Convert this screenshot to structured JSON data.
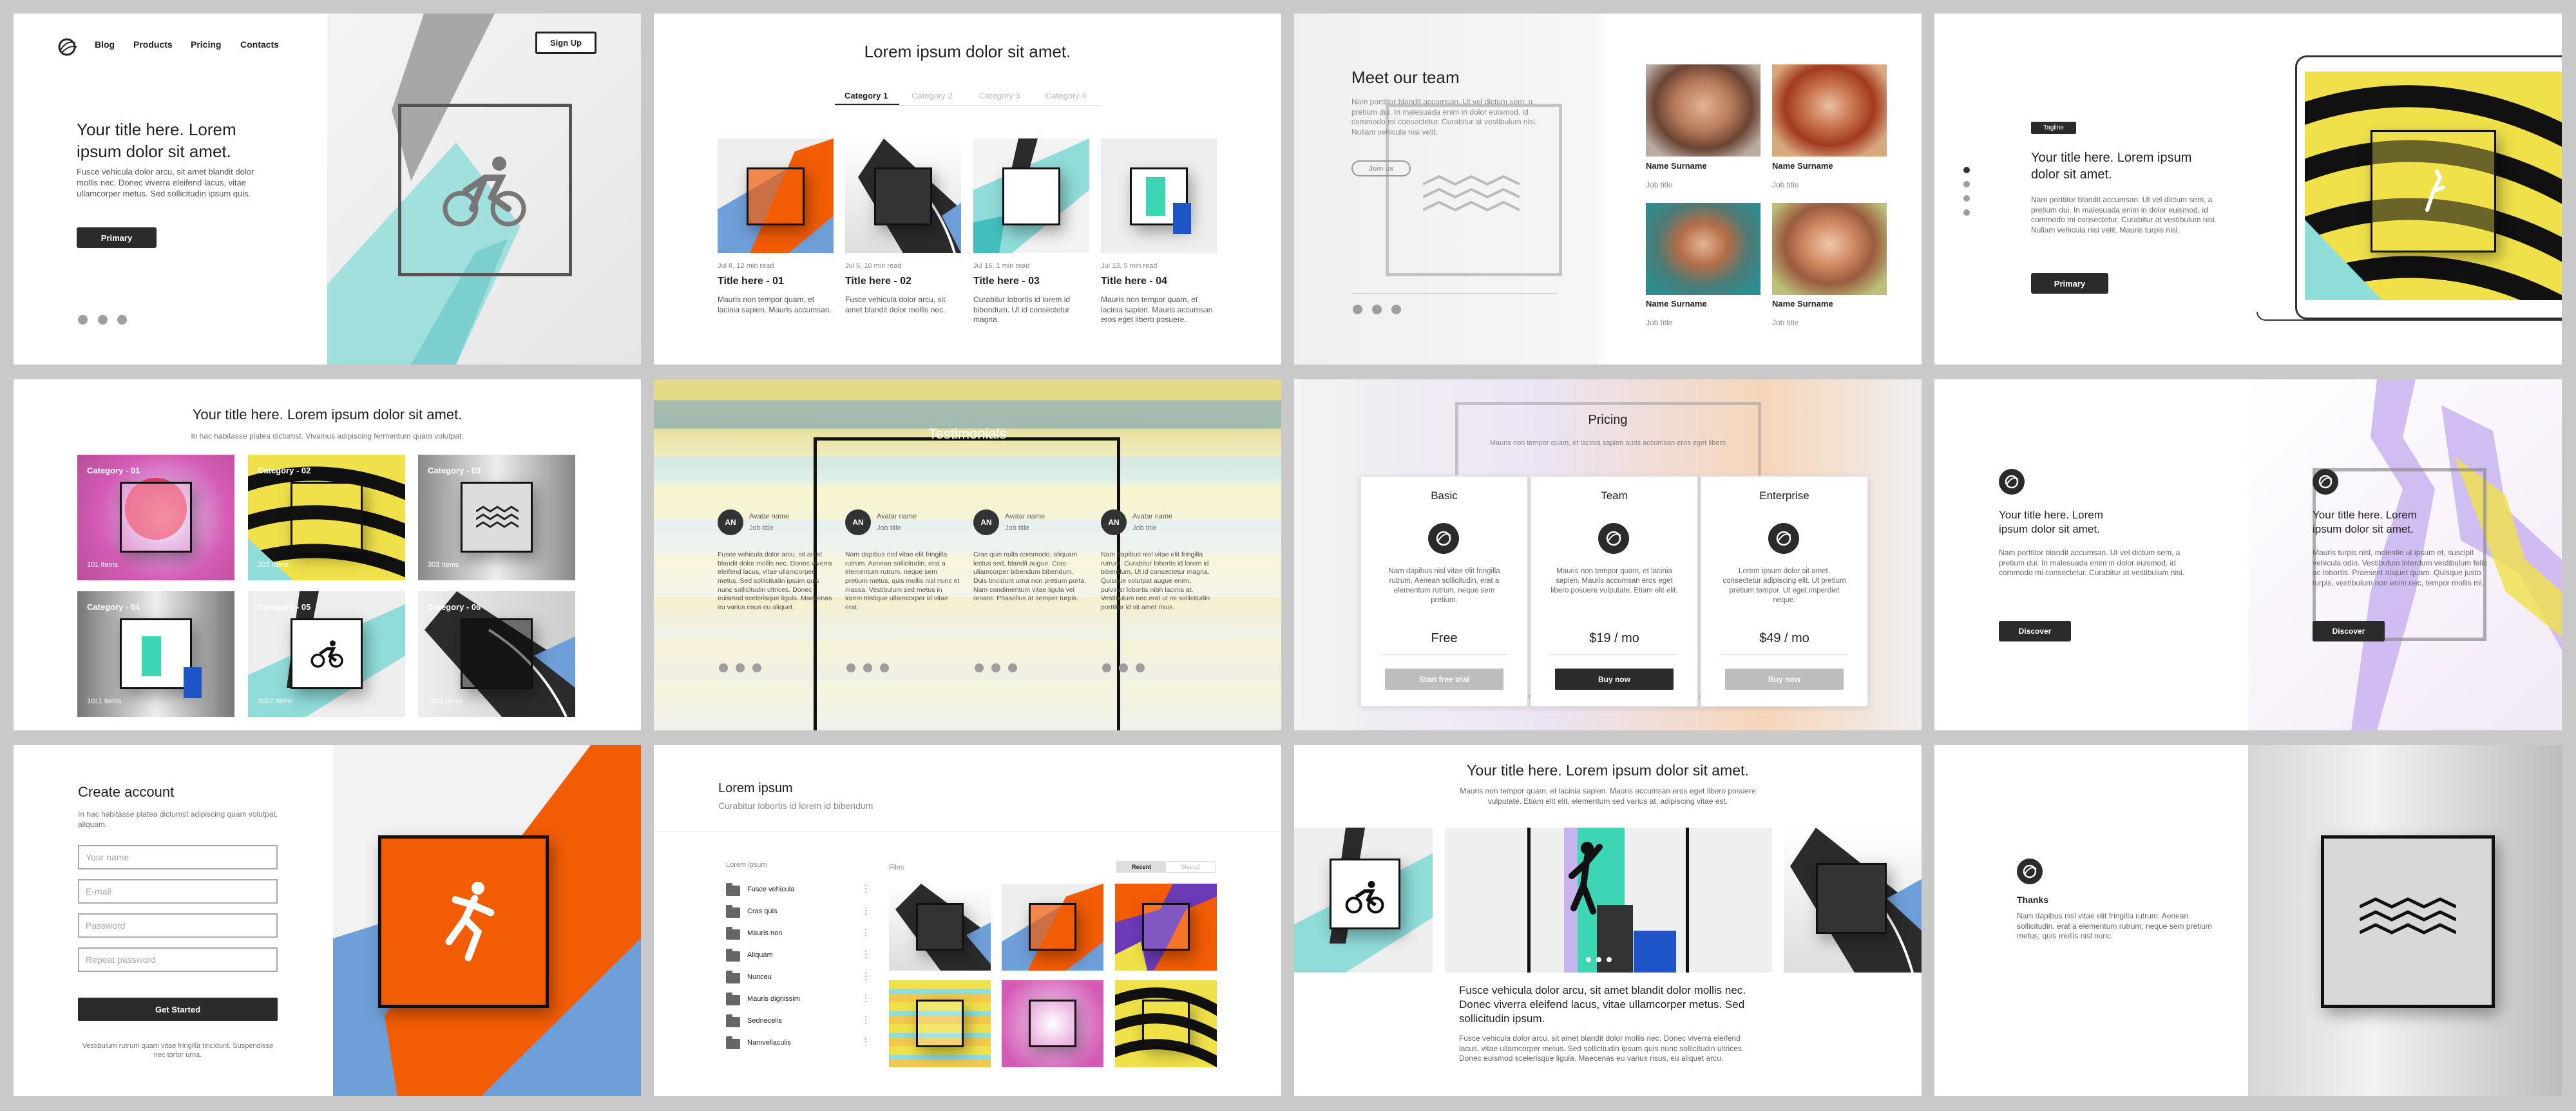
{
  "s1": {
    "nav": [
      "Blog",
      "Products",
      "Pricing",
      "Contacts"
    ],
    "signup": "Sign Up",
    "title": "Your title here. Lorem ipsum dolor sit amet.",
    "body": "Fusce vehicula dolor arcu, sit amet blandit dolor mollis nec. Donec viverra eleifend lacus, vitae ullamcorper metus. Sed sollicitudin ipsum quis.",
    "button": "Primary",
    "logo_icon": "globe-logo-icon",
    "art_icon": "cyclist-icon"
  },
  "s2": {
    "title": "Lorem ipsum dolor sit amet.",
    "tabs": [
      "Category 1",
      "Category 2",
      "Category 3",
      "Category 4"
    ],
    "posts": [
      {
        "meta": "Jul 8, 12 min read",
        "title": "Title here - 01",
        "text": "Mauris non tempor quam, et lacinia sapien. Mauris accumsan."
      },
      {
        "meta": "Jul 6, 10 min read",
        "title": "Title here - 02",
        "text": "Fusce vehicula dolor arcu, sit amet blandit dolor mollis nec."
      },
      {
        "meta": "Jul 16, 1 min read",
        "title": "Title here - 03",
        "text": "Curabitur lobortis id lorem id bibendum. Ut id consectetur magna."
      },
      {
        "meta": "Jul 13, 5 min read",
        "title": "Title here - 04",
        "text": "Mauris non tempor quam, et lacinia sapien. Mauris accumsan eros eget libero posuere."
      }
    ]
  },
  "s3": {
    "title": "Meet our team",
    "text": "Nam porttitor blandit accumsan. Ut vel dictum sem, a pretium dui. In malesuada enim in dolor euismod, id commodo mi consectetur. Curabitur at vestibulum nisi. Nullam vehicula nisi velit.",
    "button": "Join us",
    "members": [
      {
        "name": "Name Surname",
        "job": "Job title"
      },
      {
        "name": "Name Surname",
        "job": "Job title"
      },
      {
        "name": "Name Surname",
        "job": "Job title"
      },
      {
        "name": "Name Surname",
        "job": "Job title"
      }
    ]
  },
  "s4": {
    "tagline": "Tagline",
    "title": "Your title here. Lorem ipsum dolor sit amet.",
    "text": "Nam porttitor blandit accumsan. Ut vel dictum sem, a pretium dui. In malesuada enim in dolor euismod, id commodo mi consectetur. Curabitur at vestibulum nisi. Nullam vehicula nisi velit. Mauris turpis nisl.",
    "button": "Primary"
  },
  "s5": {
    "title": "Your title here. Lorem ipsum dolor sit amet.",
    "subtitle": "In hac habitasse platea dictumst. Vivamus adipiscing fermentum quam volutpat.",
    "cats": [
      {
        "name": "Category - 01",
        "count": "101 Items"
      },
      {
        "name": "Category - 02",
        "count": "202 Items"
      },
      {
        "name": "Category - 03",
        "count": "303 Items"
      },
      {
        "name": "Category - 04",
        "count": "1011 Items"
      },
      {
        "name": "Category - 05",
        "count": "2022 Items"
      },
      {
        "name": "Category - 06",
        "count": "3033 Items"
      }
    ]
  },
  "s6": {
    "title": "Testimonials",
    "items": [
      {
        "initials": "AN",
        "name": "Avatar name",
        "job": "Job title",
        "text": "Fusce vehicula dolor arcu, sit amet blandit dolor mollis nec. Donec viverra eleifend lacus, vitae ullamcorper metus. Sed sollicitudin ipsum quis nunc sollicitudin ultrices. Donec euismod scelerisque ligula. Maecenas eu varius risus eu aliquet."
      },
      {
        "initials": "AN",
        "name": "Avatar name",
        "job": "Job title",
        "text": "Nam dapibus nisl vitae elit fringilla rutrum. Aenean sollicitudin, erat a elementum rutrum, neque sem pretium metus, quis mollis nisl nunc et massa. Vestibulum sed metus in lorem tristique ullamcorper id vitae erat."
      },
      {
        "initials": "AN",
        "name": "Avatar name",
        "job": "Job title",
        "text": "Cras quis nulla commodo, aliquam lectus sed, blandit augue. Cras ullamcorper bibendum bibendum. Duis tincidunt urna non pretium porta. Nam condimentum vitae ligula vel ornare. Phasellus at semper turpis."
      },
      {
        "initials": "AN",
        "name": "Avatar name",
        "job": "Job title",
        "text": "Nam dapibus nisl vitae elit fringilla rutrum. Curabitur lobortis id lorem id bibendum. Ut id consectetur magna. Quisque volutpat augue enim, pulvinar lobortis nibh lacinia at. Vestibulum nec erat ut mi sollicitudin porttitor id sit amet risus."
      }
    ]
  },
  "s7": {
    "title": "Pricing",
    "subtitle": "Mauris non tempor quam, et lacinia sapien auris accumsan eros eget libero",
    "plans": [
      {
        "name": "Basic",
        "desc": "Nam dapibus nisl vitae elit fringilla rutrum. Aenean sollicitudin, erat a elementum rutrum, neque sem pretium.",
        "price": "Free",
        "button": "Start free trial"
      },
      {
        "name": "Team",
        "desc": "Mauris non tempor quam, et lacinia sapien. Mauris accumsan eros eget libero posuere vulputate. Etiam elit elit.",
        "price": "$19 / mo",
        "button": "Buy now"
      },
      {
        "name": "Enterprise",
        "desc": "Lorem ipsum dolor sit amet, consectetur adipiscing elit. Ut pretium pretium tempor. Ut eget imperdiet neque.",
        "price": "$49 / mo",
        "button": "Buy now"
      }
    ]
  },
  "s8": {
    "left": {
      "title": "Your title here. Lorem ipsum dolor sit amet.",
      "text": "Nam porttitor blandit accumsan. Ut vel dictum sem, a pretium dui. In malesuada enim in dolor euismod, id commodo mi consectetur. Curabitur at vestibulum nisi.",
      "button": "Discover"
    },
    "right": {
      "title": "Your title here. Lorem ipsum dolor sit amet.",
      "text": "Mauris turpis nisl, molestie ut ipsum et, suscipit vehicula odio. Vestibulum interdum vestibulum felis ac lobortis. Praesent aliquet quam. Quisque justo turpis, vestibulum non enim nec, tempor mollis mi.",
      "button": "Discover"
    }
  },
  "s9": {
    "title": "Create account",
    "text": "In hac habitasse platea dictumst adipiscing quam volutpat. aliquam.",
    "fields": [
      "Your name",
      "E-mail",
      "Password",
      "Repeat password"
    ],
    "button": "Get Started",
    "footer": "Vestibulum rutrum quam vitae fringilla tincidunt. Suspendisse nec tortor urna."
  },
  "s10": {
    "title": "Lorem ipsum",
    "subtitle": "Curabitur lobortis id lorem id bibendum",
    "side_label": "Lorem ipsum",
    "files_label": "Files",
    "toggle": [
      "Recent",
      "Shared"
    ],
    "folders": [
      "Fusce vehicula",
      "Cras quis",
      "Mauris non",
      "Aliquam",
      "Nunceu",
      "Mauris dignissim",
      "Sednecelis",
      "Namvellaculis"
    ]
  },
  "s11": {
    "title": "Your title here. Lorem ipsum dolor sit amet.",
    "subtitle": "Mauris non tempor quam, et lacinia sapien. Mauris accumsan eros eget libero posuere vulputate. Etiam elit elit, elementum sed varius at, adipiscing vitae est.",
    "heading": "Fusce vehicula dolor arcu, sit amet blandit dolor mollis nec. Donec viverra eleifend lacus, vitae ullamcorper metus. Sed sollicitudin ipsum.",
    "body": "Fusce vehicula dolor arcu, sit amet blandit dolor mollis nec. Donec viverra eleifend lacus, vitae ullamcorper metus. Sed sollicitudin ipsum quis nunc sollicitudin ultrices. Donec euismod scelerisque ligula. Maecenas eu varius risus, eu aliquet arcu."
  },
  "s12": {
    "title": "Thanks",
    "text": "Nam dapibus nisl vitae elit fringilla rutrum. Aenean sollicitudin, erat a elementum rutrum, neque sem pretium metus, quis mollis nisl nunc."
  },
  "colors": {
    "teal": "#8fdcd9",
    "orange": "#f25c05",
    "blue": "#6f9fd8",
    "yellow": "#f0e14a",
    "pink": "#e882c8",
    "dark": "#2b2b2b"
  }
}
